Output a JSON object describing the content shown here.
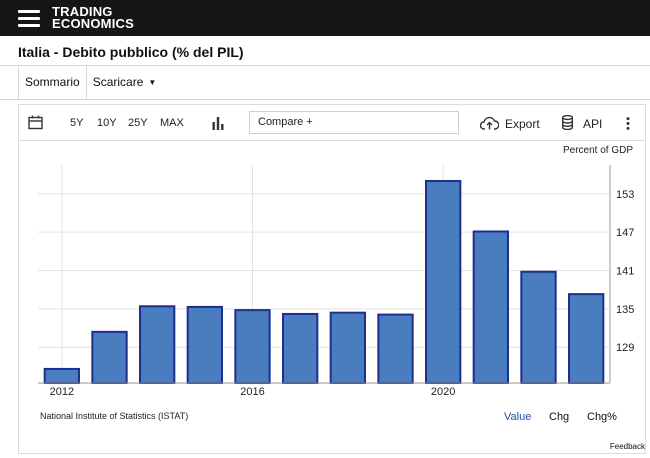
{
  "brand": {
    "line1": "TRADING",
    "line2": "ECONOMICS"
  },
  "page_title": "Italia - Debito pubblico (% del PIL)",
  "tabs": [
    {
      "label": "Sommario"
    },
    {
      "label": "Scaricare"
    }
  ],
  "toolbar": {
    "ranges": [
      "5Y",
      "10Y",
      "25Y",
      "MAX"
    ],
    "compare_placeholder": "Compare +",
    "export_label": "Export",
    "api_label": "API"
  },
  "unit_label": "Percent of GDP",
  "source_label": "National Institute of Statistics (ISTAT)",
  "value_tabs": [
    {
      "label": "Value"
    },
    {
      "label": "Chg"
    },
    {
      "label": "Chg%"
    }
  ],
  "feedback_label": "Feedback",
  "colors": {
    "bar": "#4a7cc0",
    "bar_edge": "#1c2f8f",
    "active_tab": "#1f4ea8",
    "grid": "#e4e4e4"
  },
  "icons": [
    "hamburger-menu-icon",
    "calendar-icon",
    "bar-chart-icon",
    "cloud-upload-icon",
    "database-icon",
    "more-vertical-icon",
    "caret-down-icon"
  ],
  "chart_data": {
    "type": "bar",
    "categories": [
      "2012",
      "2013",
      "2014",
      "2015",
      "2016",
      "2017",
      "2018",
      "2019",
      "2020",
      "2021",
      "2022",
      "2023"
    ],
    "values": [
      125.6,
      131.4,
      135.4,
      135.3,
      134.8,
      134.2,
      134.4,
      134.1,
      155.0,
      147.1,
      140.8,
      137.3
    ],
    "x_tick_labels": [
      "2012",
      "2016",
      "2020"
    ],
    "y_ticks": [
      129,
      135,
      141,
      147,
      153
    ],
    "ylim": [
      123.4,
      157.5
    ],
    "ylabel": "Percent of GDP",
    "grid": true,
    "y_axis_side": "right"
  }
}
